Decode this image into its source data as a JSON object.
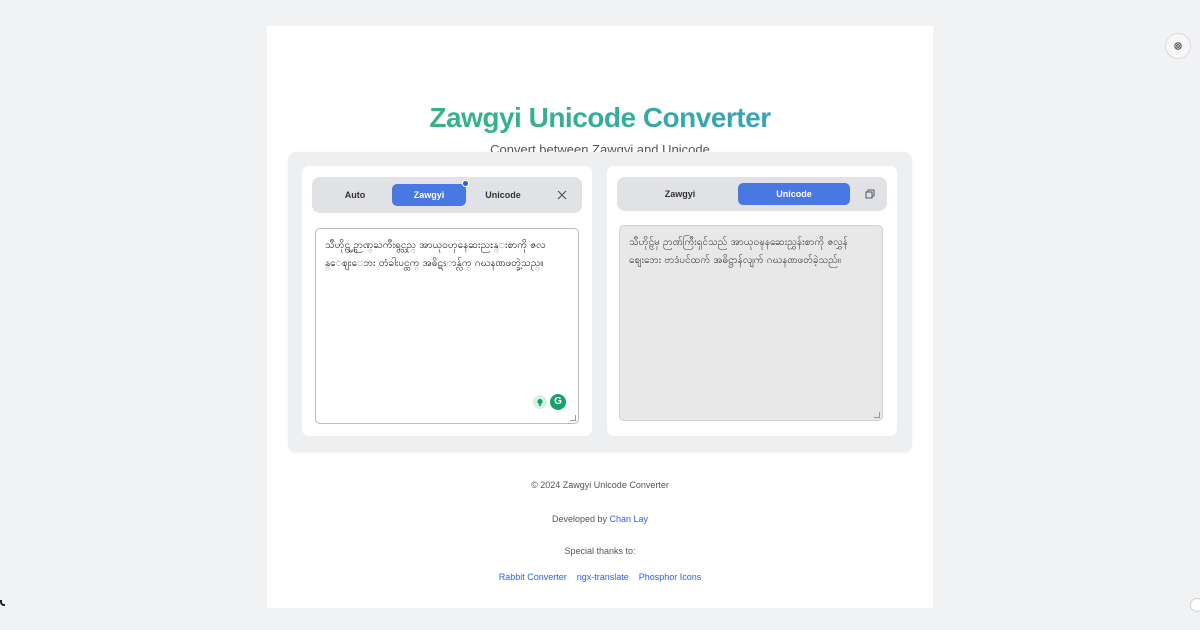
{
  "header": {
    "title": "Zawgyi Unicode Converter",
    "subtitle": "Convert between Zawgyi and Unicode"
  },
  "input_pane": {
    "tabs": [
      "Auto",
      "Zawgyi",
      "Unicode"
    ],
    "active_tab": "Zawgyi",
    "clear_icon": "close-icon",
    "text_lines": [
      "သီဟိုဠ္မွ ဉာဏ္ႀကီးရွင္သည္ အာယုဝၯနေဆးညႊန္းစာကို ဇလ",
      "န္ေဈးေဘး တံခါးပင္ထက္ အဓိဋၭာန္လ်က္ ဂဃနဏဖတ္ခဲ့သည္။"
    ]
  },
  "output_pane": {
    "tabs": [
      "Zawgyi",
      "Unicode"
    ],
    "active_tab": "Unicode",
    "copy_icon": "copy-icon",
    "text_lines": [
      "သီဟိုဠ်မှ ဉာဏ်ကြီးရှင်သည် အာယုဝဍ္ဎနဆေးညွှန်းစာကို ဇလွှန်",
      "ဈေးဘေး ဗာဒံပင်ထက် အဓိဋ္ဌာန်လျက် ဂဃနဏဖတ်ခဲ့သည်။"
    ]
  },
  "footer": {
    "copyright": "© 2024 Zawgyi Unicode Converter",
    "developed_by_prefix": "Developed by ",
    "developer_name": "Chan Lay",
    "thanks_label": "Special thanks to:",
    "thanks_links": [
      "Rabbit Converter",
      "ngx-translate",
      "Phosphor Icons"
    ]
  },
  "colors": {
    "accent": "#4a78e3",
    "link": "#2b63d9",
    "title_gradient_start": "#2fbb6f",
    "title_gradient_end": "#3a9bd6"
  }
}
